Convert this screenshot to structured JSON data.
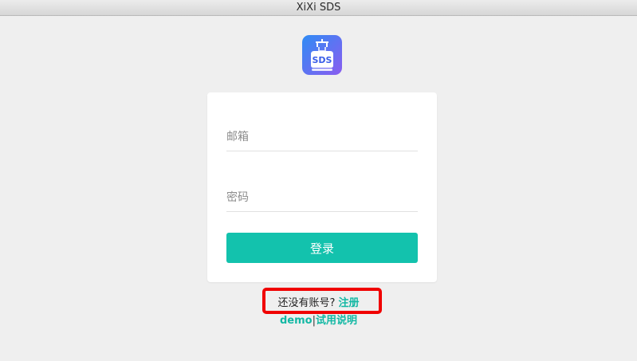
{
  "window": {
    "title": "XiXi SDS"
  },
  "logo": {
    "text": "SDS",
    "icon": "sds-app-icon"
  },
  "form": {
    "email_placeholder": "邮箱",
    "password_placeholder": "密码",
    "login_label": "登录"
  },
  "footer": {
    "register_prompt": "还没有账号?",
    "register_link": "注册",
    "demo_link": "demo",
    "separator": "|",
    "trial_link": "试用说明"
  },
  "colors": {
    "accent": "#13c2ad",
    "highlight": "#f00000",
    "background": "#efefef"
  }
}
